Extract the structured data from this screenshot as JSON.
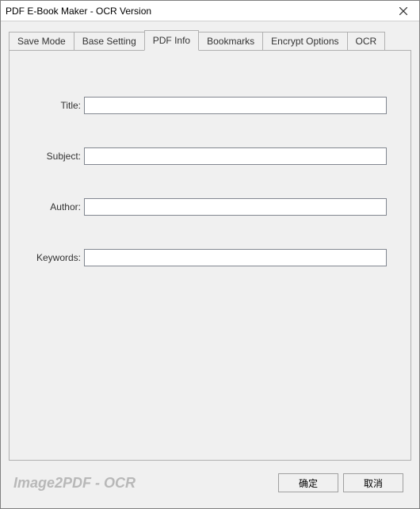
{
  "window": {
    "title": "PDF E-Book Maker - OCR Version"
  },
  "tabs": [
    {
      "label": "Save Mode",
      "active": false
    },
    {
      "label": "Base Setting",
      "active": false
    },
    {
      "label": "PDF Info",
      "active": true
    },
    {
      "label": "Bookmarks",
      "active": false
    },
    {
      "label": "Encrypt Options",
      "active": false
    },
    {
      "label": "OCR",
      "active": false
    }
  ],
  "form": {
    "title_label": "Title:",
    "title_value": "",
    "subject_label": "Subject:",
    "subject_value": "",
    "author_label": "Author:",
    "author_value": "",
    "keywords_label": "Keywords:",
    "keywords_value": ""
  },
  "footer": {
    "branding": "Image2PDF - OCR",
    "ok_label": "确定",
    "cancel_label": "取消"
  }
}
